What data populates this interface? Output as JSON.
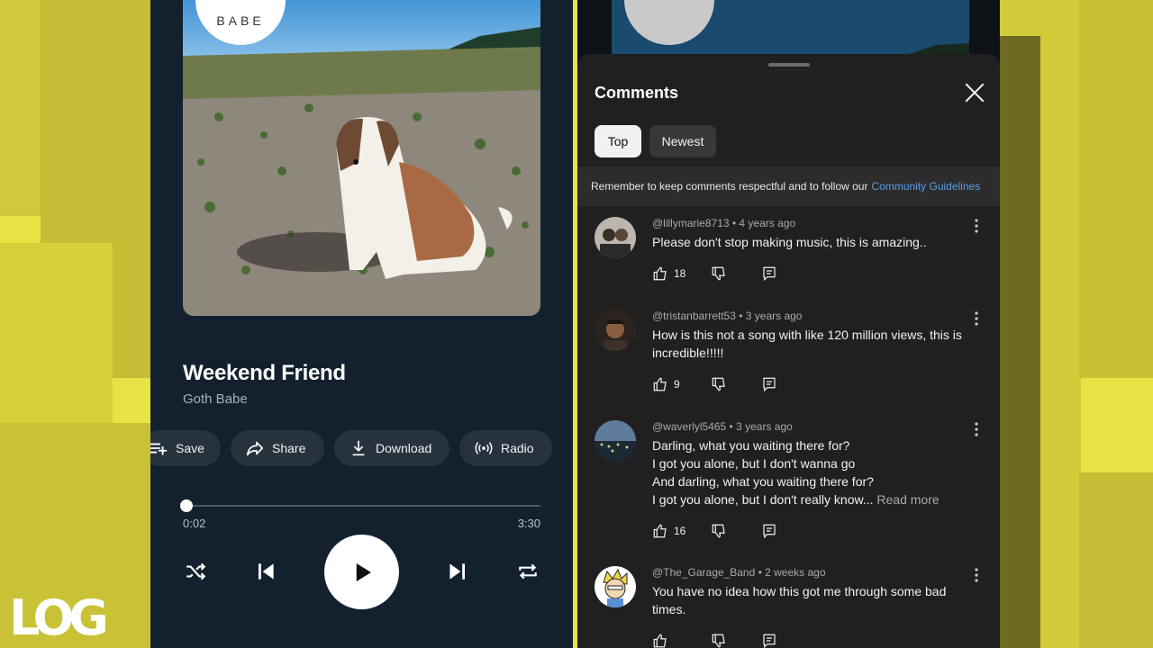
{
  "player": {
    "song_title": "Weekend Friend",
    "artist": "Goth Babe",
    "badge_text": "BABE",
    "actions": {
      "save": "Save",
      "share": "Share",
      "download": "Download",
      "radio": "Radio"
    },
    "elapsed": "0:02",
    "total": "3:30",
    "progress": 0.01
  },
  "comments_sheet": {
    "title": "Comments",
    "filters": {
      "top": "Top",
      "newest": "Newest",
      "selected": "Top"
    },
    "guidelines_text": "Remember to keep comments respectful and to follow our",
    "guidelines_link": "Community Guidelines",
    "comments": [
      {
        "meta": "@lillymarie8713 • 4 years ago",
        "text": "Please don't stop making music, this is amazing..",
        "likes": "18"
      },
      {
        "meta": "@tristanbarrett53 • 3 years ago",
        "text": "How is this not a song with like 120 million views, this is incredible!!!!!",
        "likes": "9"
      },
      {
        "meta": "@waverlyl5465 • 3 years ago",
        "lines": [
          "Darling, what you waiting there for?",
          "I got you alone, but I don't wanna go",
          "And darling, what you waiting there for?",
          "I got you alone, but I don't really know..."
        ],
        "read_more": "Read more",
        "likes": "16"
      },
      {
        "meta": "@The_Garage_Band • 2 weeks ago",
        "text": "You have no idea how this got me through some bad times.",
        "likes": ""
      }
    ]
  },
  "watermark": "LOG",
  "colors": {
    "background": "#e8e245",
    "player_bg": "#13212e",
    "sheet_bg": "#202020",
    "link": "#5c9de6"
  }
}
